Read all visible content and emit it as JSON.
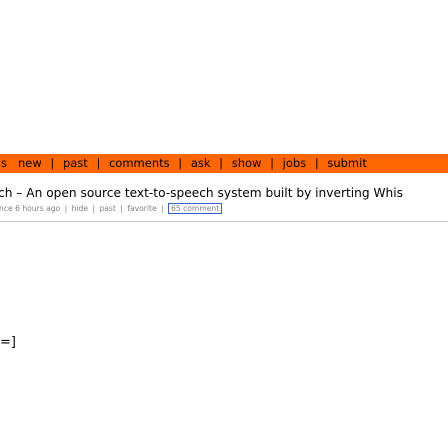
{
  "navbar": {
    "items": [
      "s",
      "new",
      "past",
      "comments",
      "ask",
      "show",
      "jobs",
      "submit"
    ],
    "separator": "|",
    "background": "#ff6600"
  },
  "story": {
    "title": "ch – An open source text-to-speech system built by inverting Whis",
    "subtext": {
      "age": "nce 6 hours ago",
      "hide": "hide",
      "past": "past",
      "favorite": "favorite",
      "comments": "65 comment"
    }
  },
  "bottom": {
    "bracket": "=]"
  }
}
